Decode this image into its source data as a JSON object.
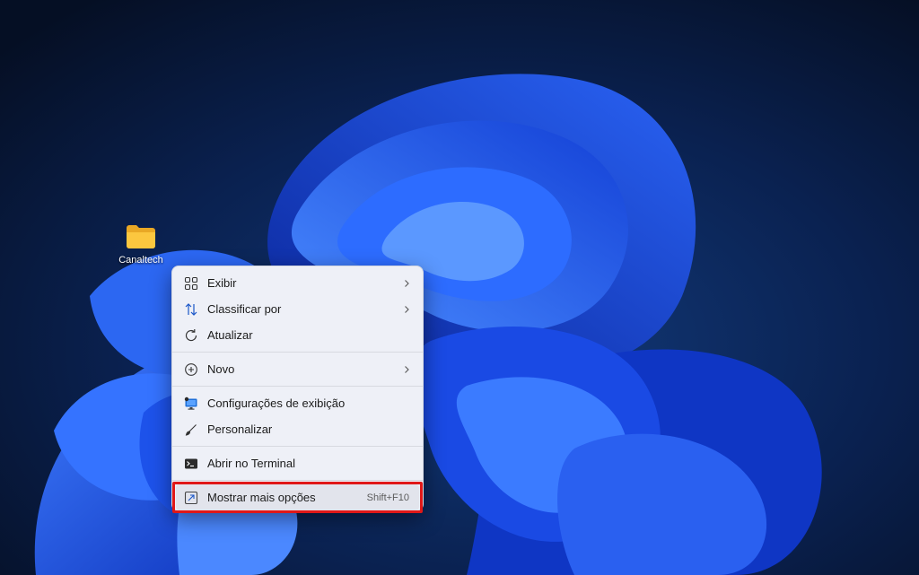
{
  "desktop": {
    "icons": [
      {
        "label": "Canaltech"
      }
    ]
  },
  "context_menu": {
    "groups": [
      [
        {
          "label": "Exibir",
          "icon": "grid-view-icon",
          "submenu": true
        },
        {
          "label": "Classificar por",
          "icon": "sort-icon",
          "submenu": true
        },
        {
          "label": "Atualizar",
          "icon": "refresh-icon",
          "submenu": false
        }
      ],
      [
        {
          "label": "Novo",
          "icon": "new-plus-icon",
          "submenu": true
        }
      ],
      [
        {
          "label": "Configurações de exibição",
          "icon": "display-settings-icon",
          "submenu": false
        },
        {
          "label": "Personalizar",
          "icon": "brush-icon",
          "submenu": false
        }
      ],
      [
        {
          "label": "Abrir no Terminal",
          "icon": "terminal-icon",
          "submenu": false
        }
      ],
      [
        {
          "label": "Mostrar mais opções",
          "icon": "show-more-options-icon",
          "shortcut": "Shift+F10",
          "highlighted": true
        }
      ]
    ]
  },
  "colors": {
    "highlight_border": "#e01818",
    "menu_background": "#eef0f7",
    "wallpaper_blue": "#1f4fe0"
  }
}
